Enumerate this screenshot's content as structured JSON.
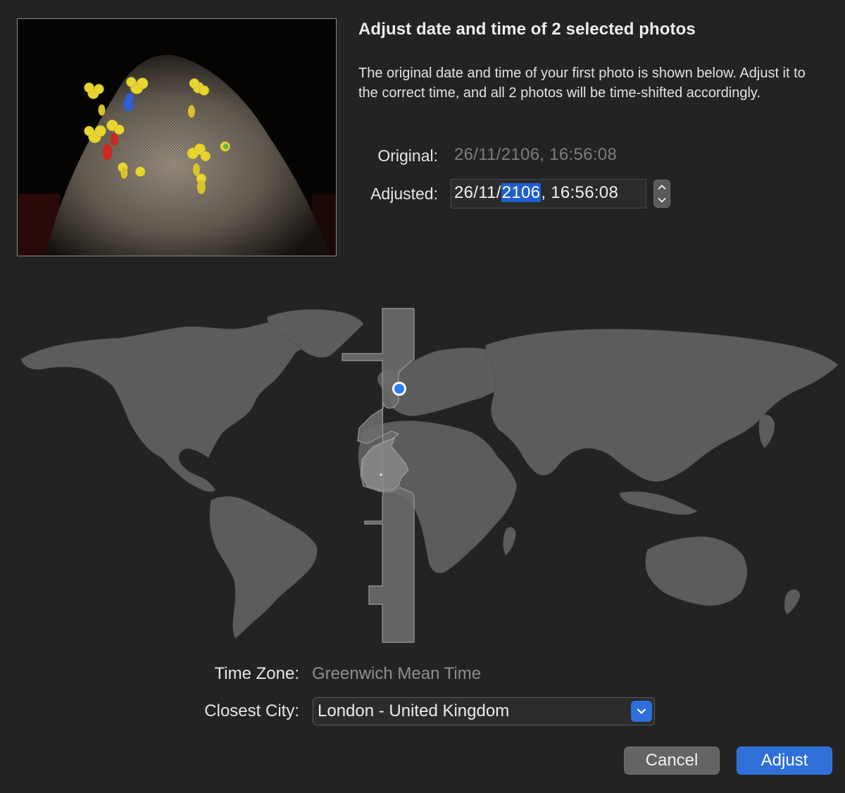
{
  "dialog": {
    "title": "Adjust date and time of 2 selected photos",
    "description": "The original date and time of your first photo is shown below. Adjust it to the correct time, and all 2 photos will be time-shifted accordingly."
  },
  "original": {
    "label": "Original:",
    "value": "26/11/2106, 16:56:08"
  },
  "adjusted": {
    "label": "Adjusted:",
    "value_prefix": "26/11/",
    "value_selected": "2106",
    "value_suffix": ", 16:56:08"
  },
  "timezone": {
    "label": "Time Zone:",
    "value": "Greenwich Mean Time"
  },
  "closest_city": {
    "label": "Closest City:",
    "value": "London - United Kingdom"
  },
  "buttons": {
    "cancel": "Cancel",
    "adjust": "Adjust"
  },
  "icons": {
    "stepper_up": "chevron-up-icon",
    "stepper_down": "chevron-down-icon",
    "dropdown": "chevron-down-icon",
    "location_marker": "location-pin-icon"
  },
  "colors": {
    "background": "#232323",
    "accent": "#2e6fd8",
    "selection": "#1f5dd0",
    "map_land": "#5c5c5c",
    "map_zone": "#6e6e6e",
    "marker": "#2f7bf5"
  }
}
